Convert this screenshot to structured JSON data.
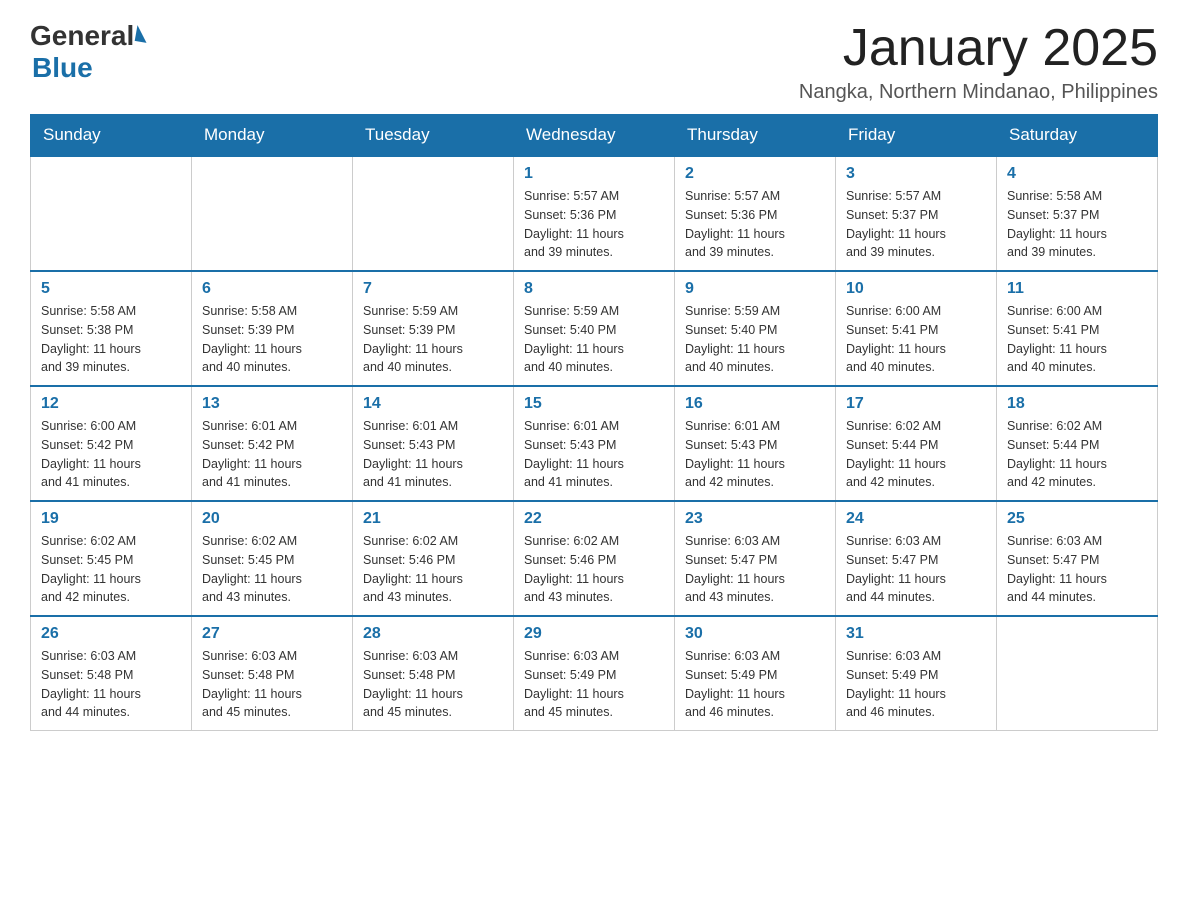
{
  "header": {
    "logo_general": "General",
    "logo_blue": "Blue",
    "title": "January 2025",
    "subtitle": "Nangka, Northern Mindanao, Philippines"
  },
  "days_of_week": [
    "Sunday",
    "Monday",
    "Tuesday",
    "Wednesday",
    "Thursday",
    "Friday",
    "Saturday"
  ],
  "weeks": [
    [
      {
        "day": "",
        "info": ""
      },
      {
        "day": "",
        "info": ""
      },
      {
        "day": "",
        "info": ""
      },
      {
        "day": "1",
        "info": "Sunrise: 5:57 AM\nSunset: 5:36 PM\nDaylight: 11 hours\nand 39 minutes."
      },
      {
        "day": "2",
        "info": "Sunrise: 5:57 AM\nSunset: 5:36 PM\nDaylight: 11 hours\nand 39 minutes."
      },
      {
        "day": "3",
        "info": "Sunrise: 5:57 AM\nSunset: 5:37 PM\nDaylight: 11 hours\nand 39 minutes."
      },
      {
        "day": "4",
        "info": "Sunrise: 5:58 AM\nSunset: 5:37 PM\nDaylight: 11 hours\nand 39 minutes."
      }
    ],
    [
      {
        "day": "5",
        "info": "Sunrise: 5:58 AM\nSunset: 5:38 PM\nDaylight: 11 hours\nand 39 minutes."
      },
      {
        "day": "6",
        "info": "Sunrise: 5:58 AM\nSunset: 5:39 PM\nDaylight: 11 hours\nand 40 minutes."
      },
      {
        "day": "7",
        "info": "Sunrise: 5:59 AM\nSunset: 5:39 PM\nDaylight: 11 hours\nand 40 minutes."
      },
      {
        "day": "8",
        "info": "Sunrise: 5:59 AM\nSunset: 5:40 PM\nDaylight: 11 hours\nand 40 minutes."
      },
      {
        "day": "9",
        "info": "Sunrise: 5:59 AM\nSunset: 5:40 PM\nDaylight: 11 hours\nand 40 minutes."
      },
      {
        "day": "10",
        "info": "Sunrise: 6:00 AM\nSunset: 5:41 PM\nDaylight: 11 hours\nand 40 minutes."
      },
      {
        "day": "11",
        "info": "Sunrise: 6:00 AM\nSunset: 5:41 PM\nDaylight: 11 hours\nand 40 minutes."
      }
    ],
    [
      {
        "day": "12",
        "info": "Sunrise: 6:00 AM\nSunset: 5:42 PM\nDaylight: 11 hours\nand 41 minutes."
      },
      {
        "day": "13",
        "info": "Sunrise: 6:01 AM\nSunset: 5:42 PM\nDaylight: 11 hours\nand 41 minutes."
      },
      {
        "day": "14",
        "info": "Sunrise: 6:01 AM\nSunset: 5:43 PM\nDaylight: 11 hours\nand 41 minutes."
      },
      {
        "day": "15",
        "info": "Sunrise: 6:01 AM\nSunset: 5:43 PM\nDaylight: 11 hours\nand 41 minutes."
      },
      {
        "day": "16",
        "info": "Sunrise: 6:01 AM\nSunset: 5:43 PM\nDaylight: 11 hours\nand 42 minutes."
      },
      {
        "day": "17",
        "info": "Sunrise: 6:02 AM\nSunset: 5:44 PM\nDaylight: 11 hours\nand 42 minutes."
      },
      {
        "day": "18",
        "info": "Sunrise: 6:02 AM\nSunset: 5:44 PM\nDaylight: 11 hours\nand 42 minutes."
      }
    ],
    [
      {
        "day": "19",
        "info": "Sunrise: 6:02 AM\nSunset: 5:45 PM\nDaylight: 11 hours\nand 42 minutes."
      },
      {
        "day": "20",
        "info": "Sunrise: 6:02 AM\nSunset: 5:45 PM\nDaylight: 11 hours\nand 43 minutes."
      },
      {
        "day": "21",
        "info": "Sunrise: 6:02 AM\nSunset: 5:46 PM\nDaylight: 11 hours\nand 43 minutes."
      },
      {
        "day": "22",
        "info": "Sunrise: 6:02 AM\nSunset: 5:46 PM\nDaylight: 11 hours\nand 43 minutes."
      },
      {
        "day": "23",
        "info": "Sunrise: 6:03 AM\nSunset: 5:47 PM\nDaylight: 11 hours\nand 43 minutes."
      },
      {
        "day": "24",
        "info": "Sunrise: 6:03 AM\nSunset: 5:47 PM\nDaylight: 11 hours\nand 44 minutes."
      },
      {
        "day": "25",
        "info": "Sunrise: 6:03 AM\nSunset: 5:47 PM\nDaylight: 11 hours\nand 44 minutes."
      }
    ],
    [
      {
        "day": "26",
        "info": "Sunrise: 6:03 AM\nSunset: 5:48 PM\nDaylight: 11 hours\nand 44 minutes."
      },
      {
        "day": "27",
        "info": "Sunrise: 6:03 AM\nSunset: 5:48 PM\nDaylight: 11 hours\nand 45 minutes."
      },
      {
        "day": "28",
        "info": "Sunrise: 6:03 AM\nSunset: 5:48 PM\nDaylight: 11 hours\nand 45 minutes."
      },
      {
        "day": "29",
        "info": "Sunrise: 6:03 AM\nSunset: 5:49 PM\nDaylight: 11 hours\nand 45 minutes."
      },
      {
        "day": "30",
        "info": "Sunrise: 6:03 AM\nSunset: 5:49 PM\nDaylight: 11 hours\nand 46 minutes."
      },
      {
        "day": "31",
        "info": "Sunrise: 6:03 AM\nSunset: 5:49 PM\nDaylight: 11 hours\nand 46 minutes."
      },
      {
        "day": "",
        "info": ""
      }
    ]
  ],
  "accent_color": "#1a6fa8"
}
